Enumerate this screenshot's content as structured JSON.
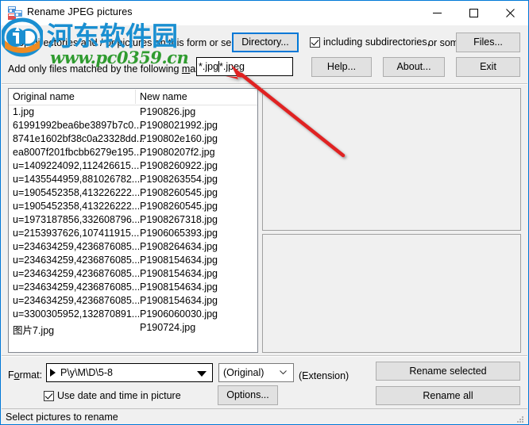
{
  "window": {
    "title": "Rename JPEG pictures",
    "icon": "app-picture-icon",
    "accent": "#0078d7",
    "controls": {
      "minimize": "–",
      "maximize": "□",
      "close": "✕"
    }
  },
  "top_panel": {
    "drop_hint_prefix": "Drop directories and / or pictures on this form or select a",
    "directory_button": "Directory...",
    "subdirectories_checkbox": {
      "label": "including subdirectories,",
      "checked": true
    },
    "or_some_label": "or some",
    "files_button": "Files...",
    "mask_label_pre": "Add only files matched by the following ",
    "mask_label_accel": "m",
    "mask_label_post": "ask(s) :",
    "mask_value_before_caret": "*.jpg",
    "mask_value_after_caret": "*.jpeg",
    "mask_value_full": "*.jpg|*.jpeg",
    "help_button": "Help...",
    "about_button": "About...",
    "exit_button": "Exit"
  },
  "list": {
    "columns": [
      "Original name",
      "New name"
    ],
    "rows": [
      {
        "original": "1.jpg",
        "new": "P190826.jpg"
      },
      {
        "original": "61991992bea6be3897b7c0...",
        "new": "P1908021992.jpg"
      },
      {
        "original": "8741e1602bf38c0a23328dd...",
        "new": "P190802e160.jpg"
      },
      {
        "original": "ea8007f201fbcbb6279e195...",
        "new": "P19080207f2.jpg"
      },
      {
        "original": "u=1409224092,112426615...",
        "new": "P1908260922.jpg"
      },
      {
        "original": "u=1435544959,881026782...",
        "new": "P1908263554.jpg"
      },
      {
        "original": "u=1905452358,413226222...",
        "new": "P1908260545.jpg"
      },
      {
        "original": "u=1905452358,413226222...",
        "new": "P1908260545.jpg"
      },
      {
        "original": "u=1973187856,332608796...",
        "new": "P1908267318.jpg"
      },
      {
        "original": "u=2153937626,107411915...",
        "new": "P1906065393.jpg"
      },
      {
        "original": "u=234634259,4236876085...",
        "new": "P1908264634.jpg"
      },
      {
        "original": "u=234634259,4236876085...",
        "new": "P1908154634.jpg"
      },
      {
        "original": "u=234634259,4236876085...",
        "new": "P1908154634.jpg"
      },
      {
        "original": "u=234634259,4236876085...",
        "new": "P1908154634.jpg"
      },
      {
        "original": "u=234634259,4236876085...",
        "new": "P1908154634.jpg"
      },
      {
        "original": "u=3300305952,132870891...",
        "new": "P1906060030.jpg"
      },
      {
        "original": "图片7.jpg",
        "new": "P190724.jpg"
      }
    ]
  },
  "preview_panels": {
    "top": "",
    "bottom": ""
  },
  "bottom_panel": {
    "format_label_pre": "F",
    "format_label_accel": "o",
    "format_label_post": "rmat:",
    "format_value": "P\\y\\M\\D\\5-8",
    "extension_value": "(Original)",
    "extension_label": "(Extension)",
    "use_date_checkbox": {
      "label": "Use date and time in picture",
      "checked": true
    },
    "options_button": "Options...",
    "rename_selected_button": "Rename selected",
    "rename_all_button": "Rename all"
  },
  "status_bar": {
    "text": "Select pictures to rename"
  },
  "watermark": {
    "chinese": "河东软件园",
    "url": "www.pc0359.cn",
    "chinese_color": "#1a8fd1",
    "url_color": "#2f9b2f"
  },
  "annotation": {
    "arrow_color": "#e02020"
  }
}
